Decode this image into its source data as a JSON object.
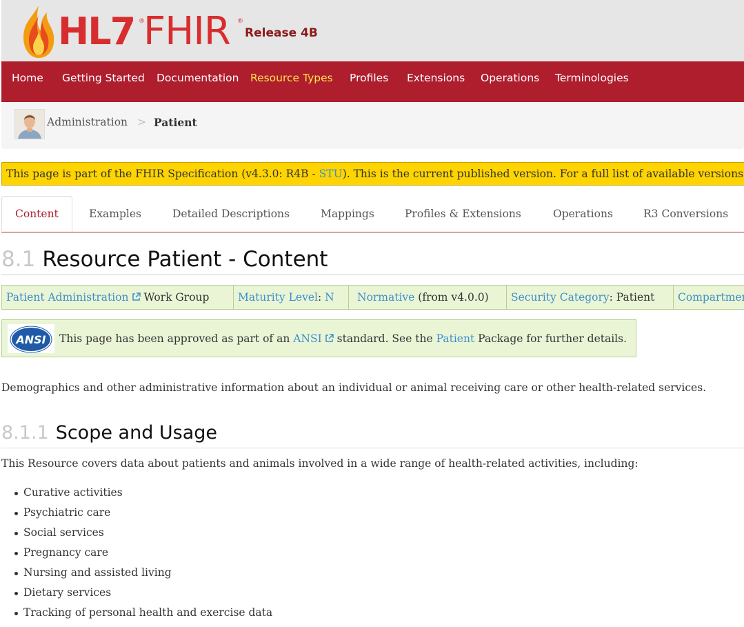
{
  "header": {
    "logo_hl7": "HL7",
    "logo_fhir": "FHIR",
    "logo_reg": "®",
    "release": "Release 4B"
  },
  "nav": {
    "items": [
      "Home",
      "Getting Started",
      "Documentation",
      "Resource Types",
      "Profiles",
      "Extensions",
      "Operations",
      "Terminologies"
    ],
    "active": "Resource Types",
    "active_color": "#ffe34d",
    "bg_color": "#ae1e2d"
  },
  "breadcrumb": {
    "section": "Administration",
    "separator": ">",
    "current": "Patient"
  },
  "status": {
    "prefix": "This page is part of the FHIR Specification (v4.3.0: R4B - ",
    "stu": "STU",
    "suffix": "). This is the current published version. For a full list of available versions"
  },
  "tabs": {
    "items": [
      "Content",
      "Examples",
      "Detailed Descriptions",
      "Mappings",
      "Profiles & Extensions",
      "Operations",
      "R3 Conversions"
    ],
    "active": "Content"
  },
  "heading": {
    "number": "8.1",
    "title": "Resource Patient - Content"
  },
  "info": {
    "workgroup_link": "Patient Administration",
    "workgroup_suffix": " Work Group",
    "maturity_label": "Maturity Level",
    "maturity_sep": ": ",
    "maturity_value": "N",
    "standards_status": "Normative",
    "standards_suffix": " (from v4.0.0)",
    "security_label": "Security Category",
    "security_value": ": Patient",
    "compartments": "Compartments"
  },
  "ansi": {
    "logo_text": "ANSI",
    "text_1": "This page has been approved as part of an ",
    "ansi_link": "ANSI",
    "text_2": " standard. See the ",
    "patient_link": "Patient",
    "text_3": " Package for further details."
  },
  "description": "Demographics and other administrative information about an individual or animal receiving care or other health-related services.",
  "scope": {
    "number": "8.1.1",
    "title": "Scope and Usage",
    "intro": "This Resource covers data about patients and animals involved in a wide range of health-related activities, including:",
    "items": [
      "Curative activities",
      "Psychiatric care",
      "Social services",
      "Pregnancy care",
      "Nursing and assisted living",
      "Dietary services",
      "Tracking of personal health and exercise data"
    ]
  }
}
